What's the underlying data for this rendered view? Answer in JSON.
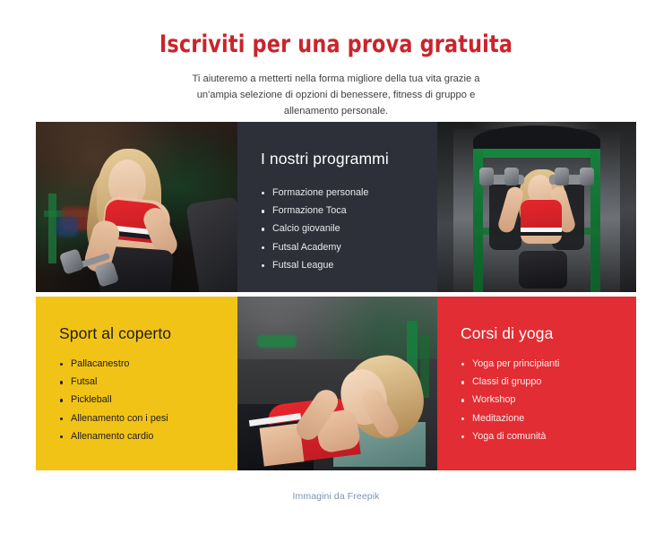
{
  "header": {
    "title": "Iscriviti per una prova gratuita",
    "subtitle": "Ti aiuteremo a metterti nella forma migliore della tua vita grazie a un'ampia selezione di opzioni di benessere, fitness di gruppo e allenamento personale."
  },
  "colors": {
    "title_red": "#C9252C",
    "panel_dark": "#2E3039",
    "panel_yellow": "#F2C317",
    "panel_red": "#E12D33",
    "footer_link": "#7D93AD",
    "page_background": "#FFFFFF"
  },
  "grid": {
    "cells": [
      {
        "name": "photo-woman-dumbbell-curl",
        "kind": "photo",
        "alt": "Donna seduta che solleva un manubrio in palestra"
      },
      {
        "name": "programs-panel",
        "kind": "panel-dark",
        "title": "I nostri programmi",
        "items": [
          "Formazione personale",
          "Formazione Toca",
          "Calcio giovanile",
          "Futsal Academy",
          "Futsal League"
        ]
      },
      {
        "name": "photo-woman-overhead-press",
        "kind": "photo",
        "alt": "Donna che esegue una distensione sopra la testa con manubri"
      },
      {
        "name": "indoor-sports-panel",
        "kind": "panel-yellow",
        "title": "Sport al coperto",
        "items": [
          "Pallacanestro",
          "Futsal",
          "Pickleball",
          "Allenamento con i pesi",
          "Allenamento cardio"
        ]
      },
      {
        "name": "photo-woman-crunches",
        "kind": "photo",
        "alt": "Donna che esegue crunch addominali a terra"
      },
      {
        "name": "yoga-panel",
        "kind": "panel-red",
        "title": "Corsi di yoga",
        "items": [
          "Yoga per principianti",
          "Classi di gruppo",
          "Workshop",
          "Meditazione",
          "Yoga di comunità"
        ]
      }
    ]
  },
  "footer": {
    "credit": "Immagini da Freepik"
  }
}
